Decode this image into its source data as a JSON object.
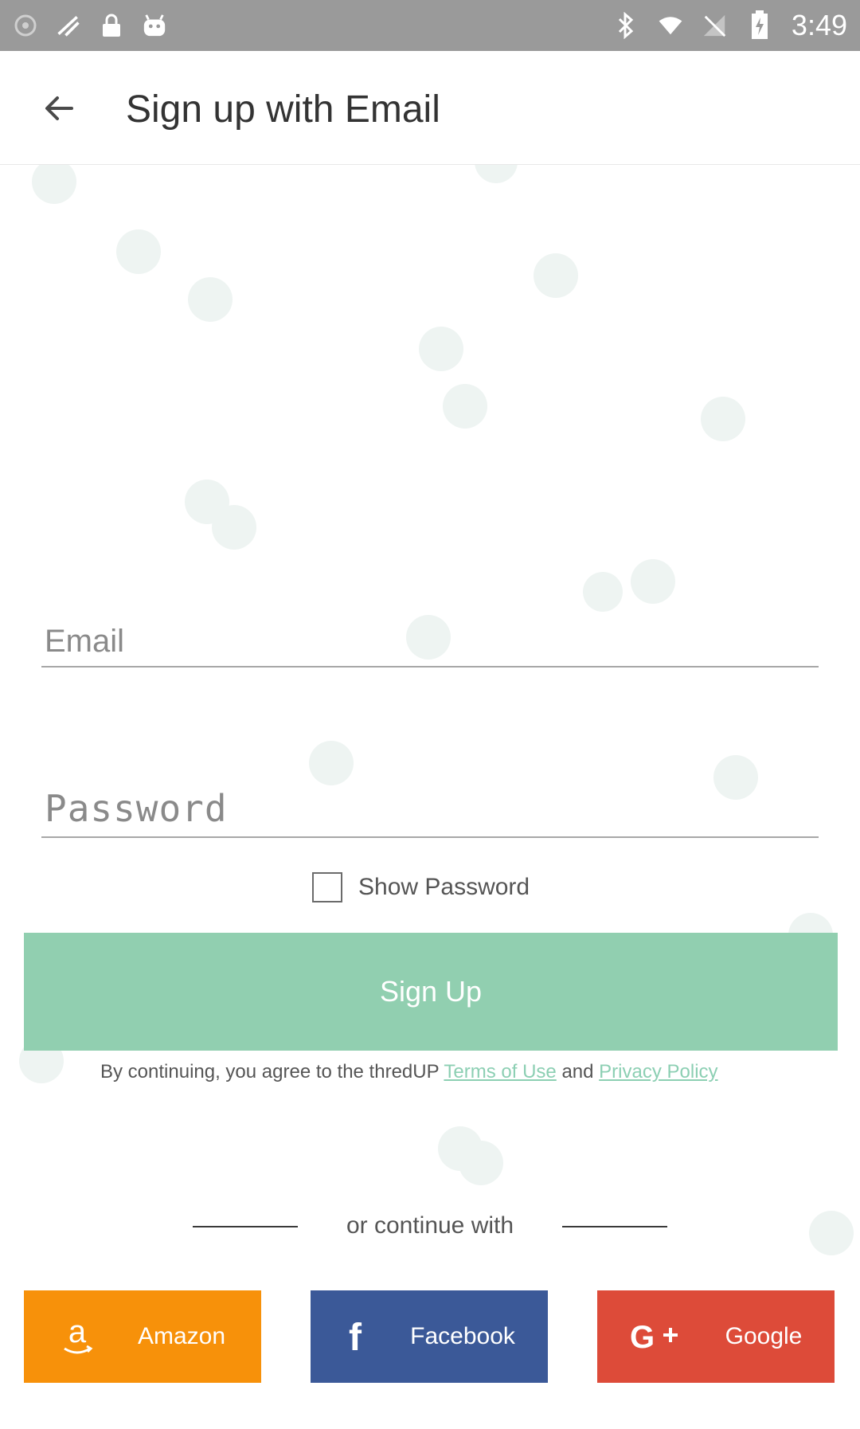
{
  "status_bar": {
    "time": "3:49",
    "icons": [
      "bluetooth-icon",
      "wifi-icon",
      "no-sim-icon",
      "battery-charging-icon"
    ],
    "left_icons": [
      "cast-icon",
      "lock-icon",
      "android-icon"
    ]
  },
  "toolbar": {
    "title": "Sign up with Email",
    "back_icon": "back-arrow-icon"
  },
  "form": {
    "email_placeholder": "Email",
    "password_placeholder": "Password",
    "show_password_label": "Show Password"
  },
  "actions": {
    "signup_label": "Sign Up"
  },
  "terms": {
    "prefix": "By continuing, you agree to the thredUP ",
    "terms_link": "Terms of Use",
    "middle": " and ",
    "privacy_link": "Privacy Policy"
  },
  "divider": {
    "text": "or continue with"
  },
  "social": {
    "amazon_label": "Amazon",
    "facebook_label": "Facebook",
    "google_label": "Google"
  },
  "colors": {
    "signup": "#91cfb0",
    "link": "#8ccfb3",
    "amazon": "#f7910a",
    "facebook": "#3b5998",
    "google": "#dd4b39"
  }
}
